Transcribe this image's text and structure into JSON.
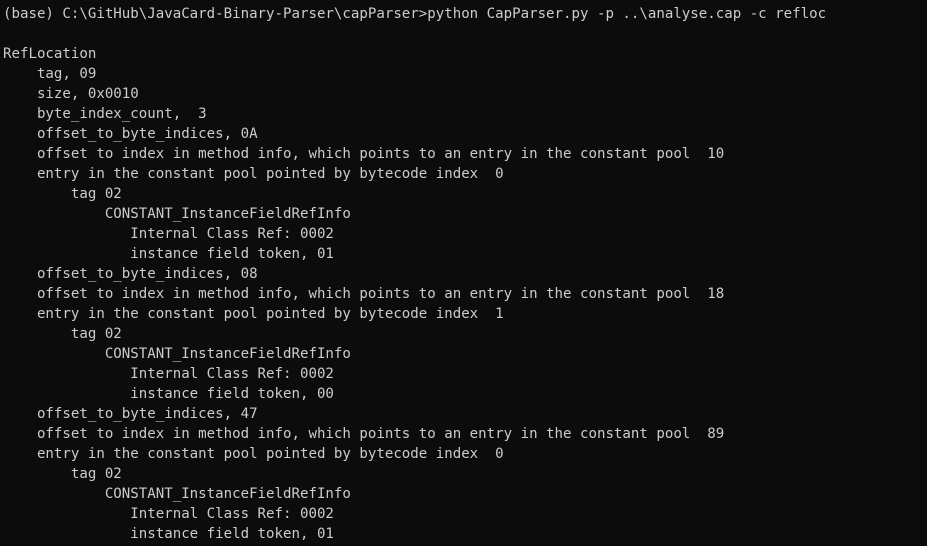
{
  "terminal": {
    "background_color": "#0c0c0c",
    "text_color": "#cccccc",
    "lines": [
      "(base) C:\\GitHub\\JavaCard-Binary-Parser\\capParser>python CapParser.py -p ..\\analyse.cap -c refloc",
      "",
      "RefLocation",
      "    tag, 09",
      "    size, 0x0010",
      "    byte_index_count,  3",
      "    offset_to_byte_indices, 0A",
      "    offset to index in method info, which points to an entry in the constant pool  10",
      "    entry in the constant pool pointed by bytecode index  0",
      "        tag 02",
      "            CONSTANT_InstanceFieldRefInfo",
      "               Internal Class Ref: 0002",
      "               instance field token, 01",
      "    offset_to_byte_indices, 08",
      "    offset to index in method info, which points to an entry in the constant pool  18",
      "    entry in the constant pool pointed by bytecode index  1",
      "        tag 02",
      "            CONSTANT_InstanceFieldRefInfo",
      "               Internal Class Ref: 0002",
      "               instance field token, 00",
      "    offset_to_byte_indices, 47",
      "    offset to index in method info, which points to an entry in the constant pool  89",
      "    entry in the constant pool pointed by bytecode index  0",
      "        tag 02",
      "            CONSTANT_InstanceFieldRefInfo",
      "               Internal Class Ref: 0002",
      "               instance field token, 01"
    ]
  }
}
